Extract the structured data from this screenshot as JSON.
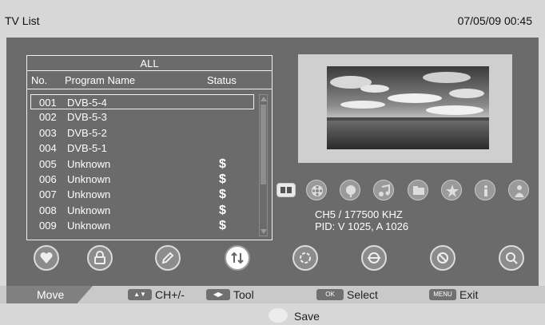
{
  "header": {
    "title": "TV List",
    "datetime": "07/05/09  00:45"
  },
  "list": {
    "group": "ALL",
    "columns": {
      "no": "No.",
      "name": "Program Name",
      "status": "Status"
    },
    "rows": [
      {
        "no": "001",
        "name": "DVB-5-4",
        "status": ""
      },
      {
        "no": "002",
        "name": "DVB-5-3",
        "status": ""
      },
      {
        "no": "003",
        "name": "DVB-5-2",
        "status": ""
      },
      {
        "no": "004",
        "name": "DVB-5-1",
        "status": ""
      },
      {
        "no": "005",
        "name": "Unknown",
        "status": "$"
      },
      {
        "no": "006",
        "name": "Unknown",
        "status": "$"
      },
      {
        "no": "007",
        "name": "Unknown",
        "status": "$"
      },
      {
        "no": "008",
        "name": "Unknown",
        "status": "$"
      },
      {
        "no": "009",
        "name": "Unknown",
        "status": "$"
      }
    ]
  },
  "channel_info": {
    "line1": "CH5 / 177500  KHZ",
    "line2": "PID: V 1025, A 1026"
  },
  "footer": {
    "move": "Move",
    "ch_key": "▲▼",
    "ch_label": "CH+/-",
    "tool_key": "◀▶",
    "tool_label": "Tool",
    "select_key": "OK",
    "select_label": "Select",
    "exit_key": "MENU",
    "exit_label": "Exit",
    "save_label": "Save"
  },
  "categories": [
    "list-icon",
    "film-icon",
    "globe-icon",
    "music-icon",
    "folder-icon",
    "star-icon",
    "info-icon",
    "person-icon"
  ],
  "functions": [
    "favorite-icon",
    "lock-icon",
    "edit-icon",
    "sort-icon",
    "skip-icon",
    "move-icon",
    "delete-icon",
    "find-icon"
  ]
}
